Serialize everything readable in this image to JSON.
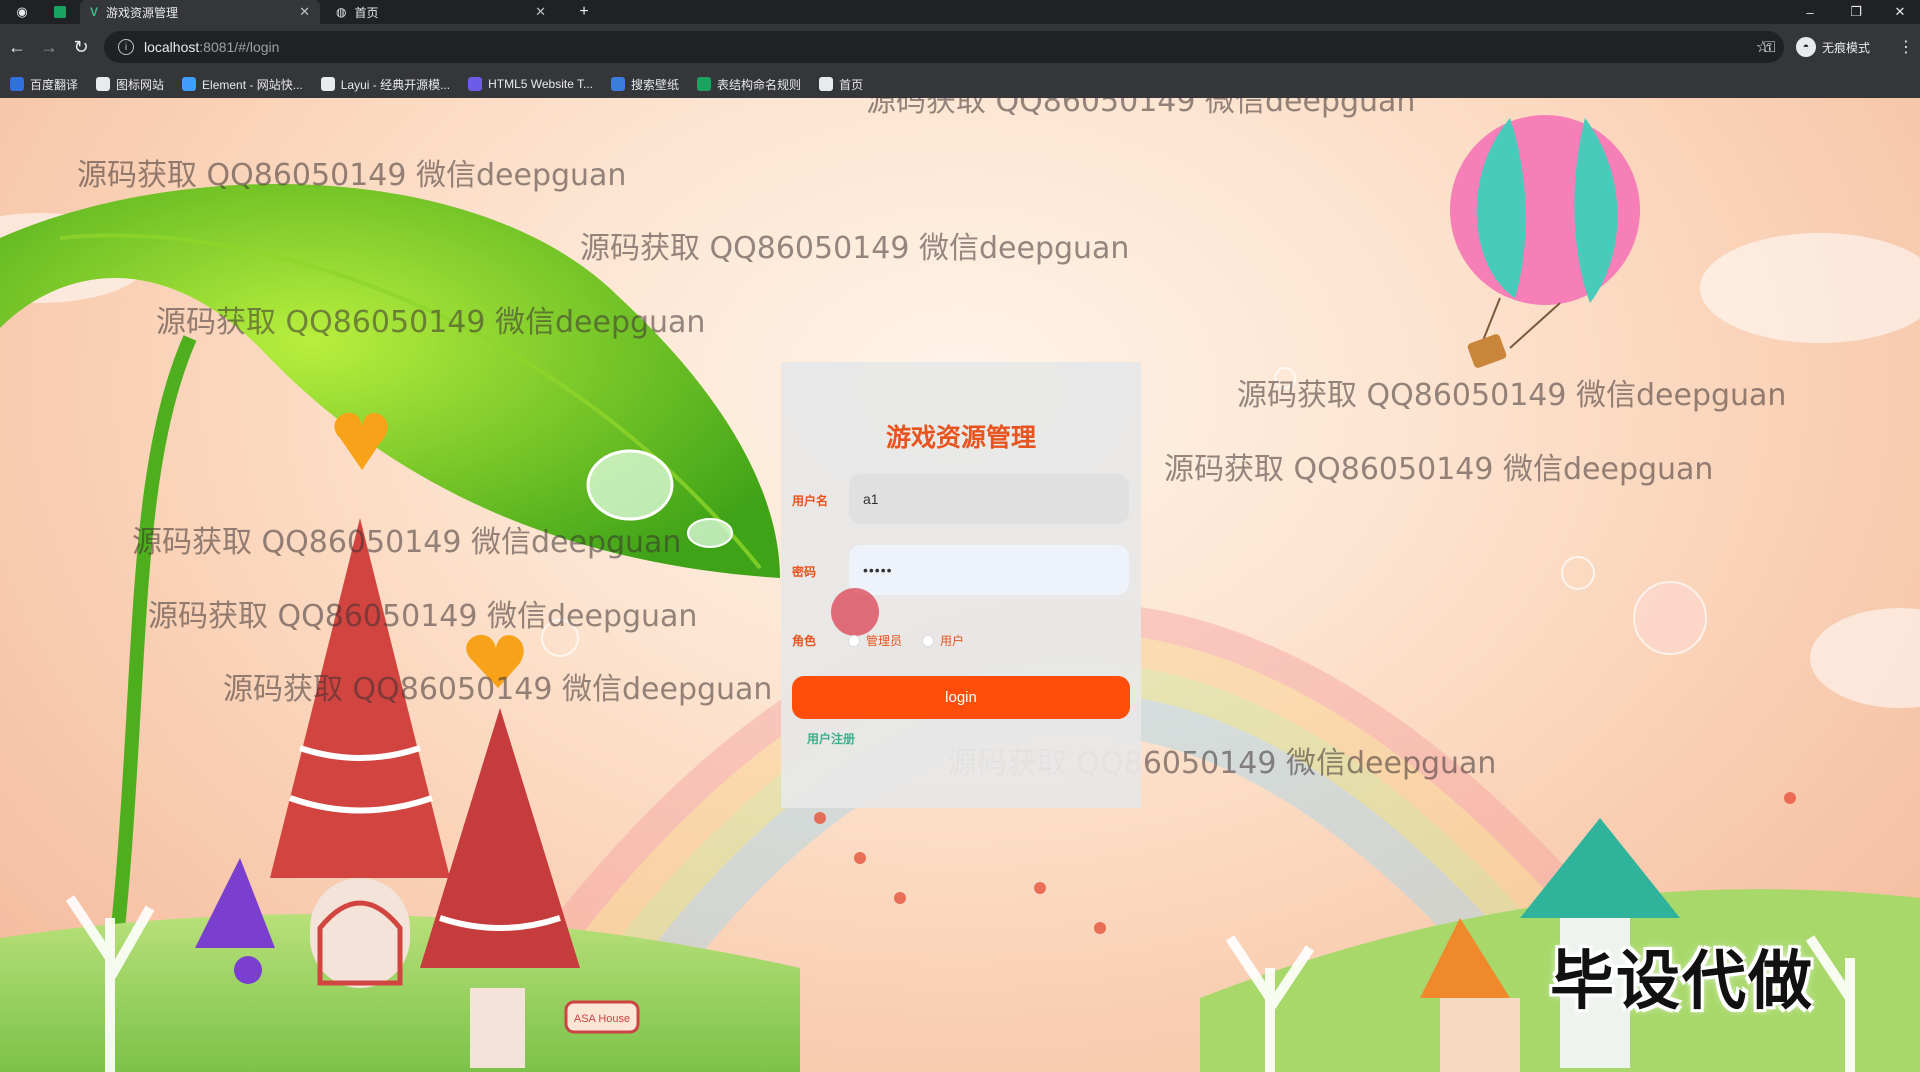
{
  "browser": {
    "tabs": [
      {
        "title": "游戏资源管理",
        "active": true
      },
      {
        "title": "首页",
        "active": false
      }
    ],
    "new_tab": "+",
    "url": {
      "host": "localhost",
      "path": ":8081/#/login"
    },
    "incognito_label": "无痕模式",
    "bookmarks": [
      {
        "label": "百度翻译",
        "icon": "translate-icon",
        "color": "#2f6fde"
      },
      {
        "label": "图标网站",
        "icon": "flag-icon",
        "color": "#e8eaed"
      },
      {
        "label": "Element - 网站快...",
        "icon": "element-icon",
        "color": "#409eff"
      },
      {
        "label": "Layui - 经典开源模...",
        "icon": "layui-icon",
        "color": "#e8eaed"
      },
      {
        "label": "HTML5 Website T...",
        "icon": "html5-icon",
        "color": "#6c5ce7"
      },
      {
        "label": "搜索壁纸",
        "icon": "wallpaper-icon",
        "color": "#3b7ddd"
      },
      {
        "label": "表结构命名规则",
        "icon": "doc-icon",
        "color": "#1aa260"
      },
      {
        "label": "首页",
        "icon": "globe-icon",
        "color": "#e8eaed"
      }
    ]
  },
  "watermark_text": "源码获取 QQ86050149 微信deepguan",
  "login": {
    "title": "游戏资源管理",
    "username_label": "用户名",
    "username_value": "a1",
    "password_label": "密码",
    "password_value": "•••••",
    "role_label": "角色",
    "role_options": [
      "管理员",
      "用户"
    ],
    "login_button": "login",
    "register_link": "用户注册"
  },
  "promo_text": "毕设代做",
  "colors": {
    "accent": "#ff4e0c",
    "title": "#e8541e",
    "register": "#3cb08f"
  }
}
